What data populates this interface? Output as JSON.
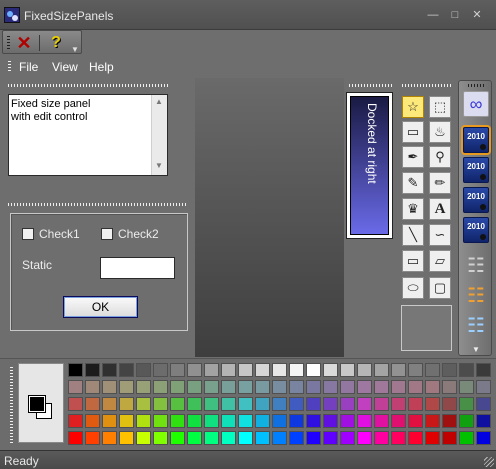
{
  "window": {
    "title": "FixedSizePanels",
    "minimize_icon": "minimize-icon",
    "maximize_icon": "maximize-icon",
    "close_icon": "close-icon"
  },
  "toolbar": {
    "items": [
      "delete-icon",
      "help-icon"
    ]
  },
  "menu": {
    "items": [
      "File",
      "View",
      "Help"
    ]
  },
  "edit_panel": {
    "text": "Fixed size panel\nwith edit control"
  },
  "form_panel": {
    "check1_label": "Check1",
    "check2_label": "Check2",
    "check1_checked": false,
    "check2_checked": false,
    "static_label": "Static",
    "static_value": "",
    "ok_label": "OK"
  },
  "docked_panel": {
    "label": "Docked at right",
    "colors": {
      "top": "#1a1a44",
      "bottom": "#6a6ae8"
    }
  },
  "tools": [
    [
      "free-select-icon",
      "rect-select-icon"
    ],
    [
      "eraser-icon",
      "fill-icon"
    ],
    [
      "eyedropper-icon",
      "magnifier-icon"
    ],
    [
      "pencil-icon",
      "brush-icon"
    ],
    [
      "airbrush-icon",
      "text-icon"
    ],
    [
      "line-icon",
      "curve-icon"
    ],
    [
      "rectangle-icon",
      "polygon-icon"
    ],
    [
      "ellipse-icon",
      "rounded-rect-icon"
    ]
  ],
  "active_tool": "free-select-icon",
  "text_tool_glyph": "A",
  "right_toolbar": {
    "vs_label": "2010",
    "items": [
      "infinity-icon",
      "vs2010-icon",
      "vs2010-icon",
      "vs2010-icon",
      "vs2010-icon",
      "network-icon",
      "network-icon",
      "network-icon"
    ]
  },
  "palette": {
    "foreground": "#000000",
    "background": "#ffffff",
    "rows": [
      [
        "#000000",
        "#1c1c1c",
        "#303030",
        "#444444",
        "#585858",
        "#6c6c6c",
        "#7e7e7e",
        "#909090",
        "#a2a2a2",
        "#b4b4b4",
        "#c6c6c6",
        "#d6d6d6",
        "#e6e6e6",
        "#f4f4f4",
        "#ffffff",
        "#dadada",
        "#c8c8c8",
        "#b6b6b6",
        "#a4a4a4",
        "#929292",
        "#808080",
        "#707070",
        "#5e5e5e",
        "#4c4c4c",
        "#3a3a3a"
      ],
      [
        "#a08080",
        "#a08878",
        "#a09078",
        "#a09c78",
        "#98a078",
        "#8ca078",
        "#80a078",
        "#78a080",
        "#78a08c",
        "#78a098",
        "#78a0a0",
        "#789aa0",
        "#788ea0",
        "#7884a0",
        "#7a78a0",
        "#8678a0",
        "#9278a0",
        "#9e78a0",
        "#a0789a",
        "#a07890",
        "#a07886",
        "#a07880",
        "#8a7a7a",
        "#7a8a7a",
        "#7a7a8a"
      ],
      [
        "#c05050",
        "#c06840",
        "#c08840",
        "#c0a840",
        "#a8c040",
        "#84c040",
        "#58c040",
        "#40c058",
        "#40c080",
        "#40c0a4",
        "#40c0c0",
        "#40a4c0",
        "#4080c0",
        "#405cc0",
        "#5040c0",
        "#7440c0",
        "#9840c0",
        "#c040c0",
        "#c04098",
        "#c04074",
        "#c04058",
        "#b04848",
        "#904848",
        "#489048",
        "#484890"
      ],
      [
        "#e02020",
        "#e05a10",
        "#e09010",
        "#e0c010",
        "#b0e010",
        "#70e010",
        "#30e010",
        "#10e040",
        "#10e080",
        "#10e0b8",
        "#10e0e0",
        "#10b0e0",
        "#1070e0",
        "#1038e0",
        "#3010e0",
        "#6010e0",
        "#a010e0",
        "#e010e0",
        "#e010a0",
        "#e01070",
        "#e01040",
        "#c81818",
        "#a01010",
        "#10a010",
        "#1010a0"
      ],
      [
        "#ff0000",
        "#ff4000",
        "#ff8000",
        "#ffc000",
        "#c8ff00",
        "#80ff00",
        "#20ff00",
        "#00ff40",
        "#00ff80",
        "#00ffc0",
        "#00ffff",
        "#00c0ff",
        "#0080ff",
        "#0040ff",
        "#2000ff",
        "#6000ff",
        "#a000ff",
        "#ff00ff",
        "#ff00a0",
        "#ff0060",
        "#ff0030",
        "#e00000",
        "#c00000",
        "#00c000",
        "#0000e0"
      ]
    ]
  },
  "status": {
    "text": "Ready"
  }
}
